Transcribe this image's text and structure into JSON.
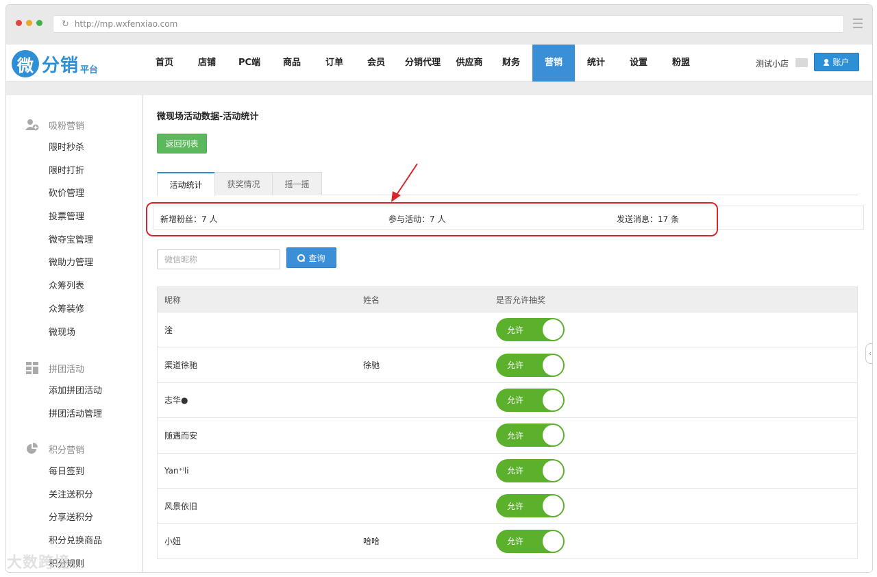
{
  "browser": {
    "url": "http://mp.wxfenxiao.com",
    "dot_colors": [
      "#e0443a",
      "#e8a729",
      "#3fb04a"
    ]
  },
  "logo": {
    "mark": "微",
    "text": "分销",
    "sub": "平台"
  },
  "nav": {
    "items": [
      "首页",
      "店铺",
      "PC端",
      "商品",
      "订单",
      "会员",
      "分销代理",
      "供应商",
      "财务",
      "营销",
      "统计",
      "设置",
      "粉盟"
    ],
    "active": "营销",
    "shop_name": "测试小店",
    "account_label": "账户"
  },
  "sidebar": {
    "groups": [
      {
        "title": "吸粉营销",
        "icon": "user-plus-icon",
        "items": [
          "限时秒杀",
          "限时打折",
          "砍价管理",
          "投票管理",
          "微夺宝管理",
          "微助力管理",
          "众筹列表",
          "众筹装修",
          "微现场"
        ]
      },
      {
        "title": "拼团活动",
        "icon": "grid-icon",
        "items": [
          "添加拼团活动",
          "拼团活动管理"
        ]
      },
      {
        "title": "积分营销",
        "icon": "pie-chart-icon",
        "items": [
          "每日签到",
          "关注送积分",
          "分享送积分",
          "积分兑换商品",
          "积分规则"
        ]
      }
    ]
  },
  "main": {
    "title": "微现场活动数据-活动统计",
    "back_button": "返回列表",
    "tabs": [
      "活动统计",
      "获奖情况",
      "摇一摇"
    ],
    "active_tab": "活动统计",
    "stats": {
      "new_fans": "新增粉丝：7 人",
      "participants": "参与活动：7 人",
      "messages": "发送消息：17 条"
    },
    "search": {
      "placeholder": "微信昵称",
      "button": "查询"
    },
    "table": {
      "headers": [
        "昵称",
        "姓名",
        "是否允许抽奖"
      ],
      "rows": [
        {
          "nickname": "淦",
          "name": "",
          "status": "允许"
        },
        {
          "nickname": "渠道徐驰",
          "name": "徐驰",
          "status": "允许"
        },
        {
          "nickname": "志华●",
          "name": "",
          "status": "允许"
        },
        {
          "nickname": "随遇而安",
          "name": "",
          "status": "允许"
        },
        {
          "nickname": "Yan⁺ˡli",
          "name": "",
          "status": "允许"
        },
        {
          "nickname": "风景依旧",
          "name": "",
          "status": "允许"
        },
        {
          "nickname": "小妞",
          "name": "哈哈",
          "status": "允许"
        }
      ]
    }
  },
  "watermark": "大数跨境",
  "colors": {
    "primary": "#3a8fd6",
    "success": "#5cb85c",
    "toggle": "#5bb02c",
    "highlight": "#d9252a"
  }
}
